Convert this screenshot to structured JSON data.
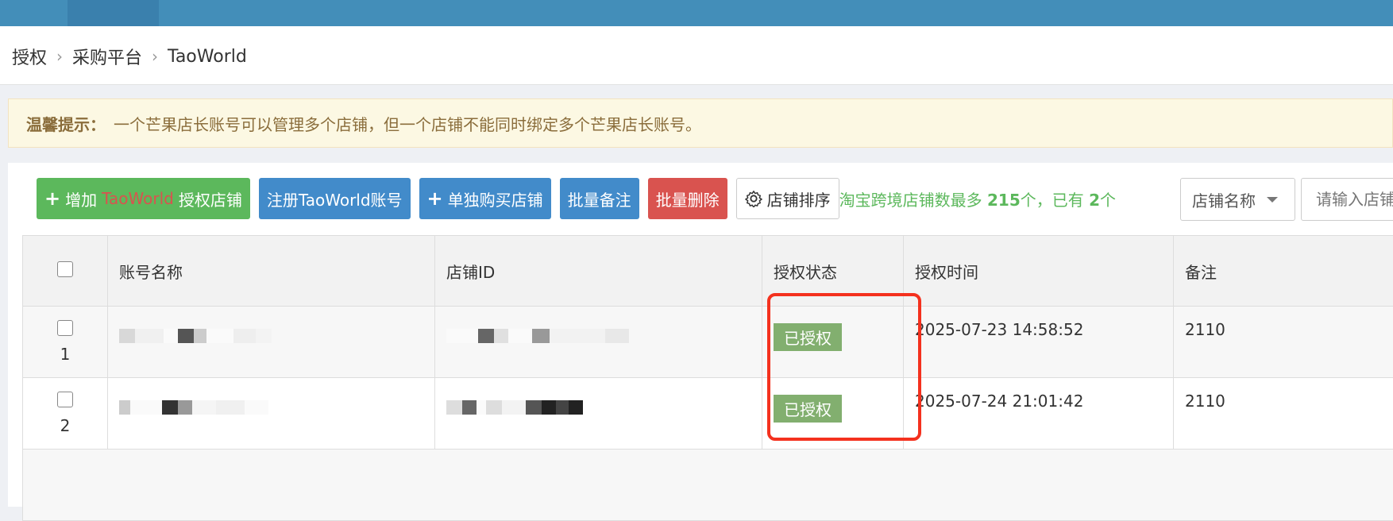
{
  "breadcrumb": [
    "授权",
    "采购平台",
    "TaoWorld"
  ],
  "notice": {
    "label": "温馨提示：",
    "text": "一个芒果店长账号可以管理多个店铺，但一个店铺不能同时绑定多个芒果店长账号。"
  },
  "toolbar": {
    "add_prefix": "增加",
    "add_brand": "TaoWorld",
    "add_suffix": "授权店铺",
    "register": "注册TaoWorld账号",
    "buy_shop": "单独购买店铺",
    "batch_note": "批量备注",
    "batch_delete": "批量删除",
    "sort": "店铺排序",
    "quota_prefix": "淘宝跨境店铺数最多",
    "quota_max": "215",
    "quota_mid": "个，已有",
    "quota_have": "2",
    "quota_suffix": "个"
  },
  "filter": {
    "select_value": "店铺名称",
    "search_placeholder": "请输入店铺"
  },
  "table": {
    "headers": [
      "账号名称",
      "店铺ID",
      "授权状态",
      "授权时间",
      "备注"
    ],
    "rows": [
      {
        "num": "1",
        "status": "已授权",
        "time": "2025-07-23 14:58:52",
        "note": "2110"
      },
      {
        "num": "2",
        "status": "已授权",
        "time": "2025-07-24 21:01:42",
        "note": "2110"
      }
    ]
  },
  "colors": {
    "topbar": "#438eb9",
    "success": "#5cb85c",
    "primary": "#428bca",
    "danger": "#d9534f",
    "badge": "#82af6f",
    "highlight": "#f4311e"
  }
}
